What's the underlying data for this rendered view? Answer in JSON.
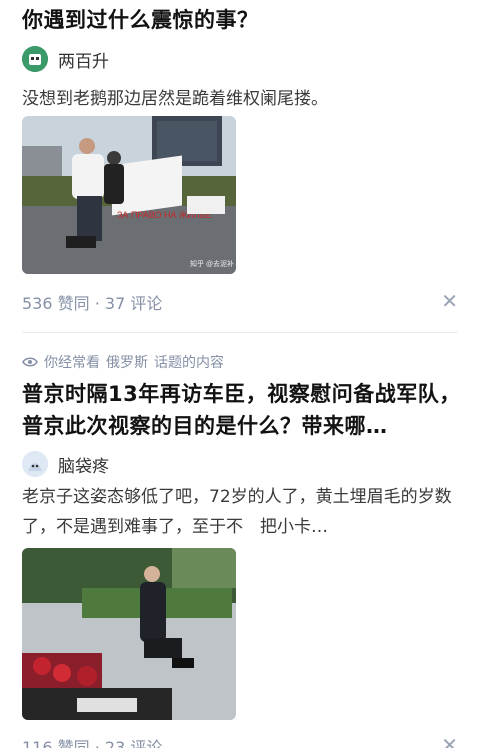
{
  "card1": {
    "title": "你遇到过什么震惊的事？",
    "author": "两百升",
    "excerpt": "没想到老鹅那边居然是跪着维权阑尾搂。",
    "image_watermark": "知乎 @去泥补",
    "image_banner": "ЗА ПРАВО НА ЖИЛЬЕ",
    "stats": "536 赞同 · 37 评论",
    "close_icon": "close-icon"
  },
  "card2": {
    "topic_prefix": "你经常看",
    "topic_name": "俄罗斯",
    "topic_suffix": "话题的内容",
    "title": "普京时隔13年再访车臣，视察慰问备战军队，普京此次视察的目的是什么？带来哪…",
    "author": "脑袋疼",
    "excerpt": "老京子这姿态够低了吧，72岁的人了，黄土埋眉毛的岁数了，不是遇到难事了，至于不　把小卡…",
    "stats": "116 赞同 · 23 评论"
  }
}
